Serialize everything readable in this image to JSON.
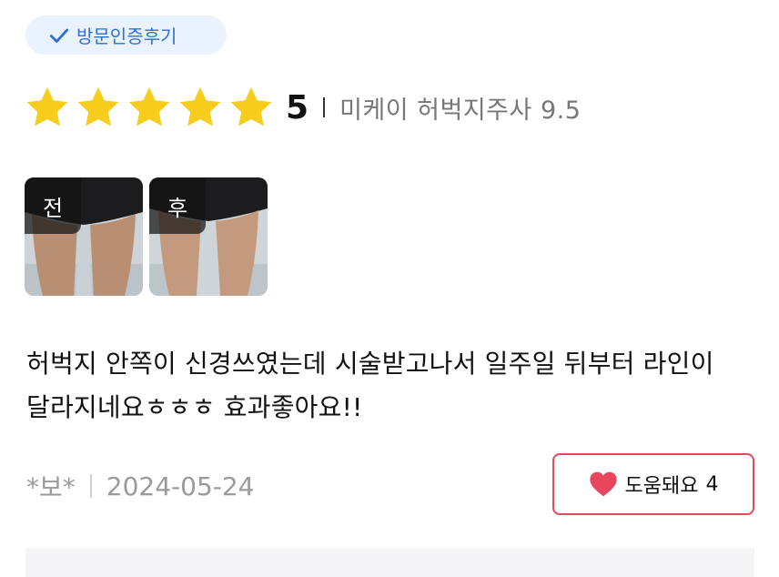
{
  "badge": {
    "label": "방문인증후기",
    "icon": "check-icon",
    "color": "#2f6fd6"
  },
  "rating": {
    "stars": 5,
    "score": "5",
    "product": "미케이 허벅지주사 9.5",
    "star_color": "#f7cc1b"
  },
  "photos": [
    {
      "tag": "전"
    },
    {
      "tag": "후"
    }
  ],
  "review": {
    "text": "허벅지 안쪽이 신경쓰였는데 시술받고나서 일주일 뒤부터 라인이 달라지네요ㅎㅎㅎ 효과좋아요!!"
  },
  "meta": {
    "author": "*보*",
    "date": "2024-05-24"
  },
  "helpful_button": {
    "label": "도움돼요",
    "count": "4",
    "icon": "heart-icon",
    "accent": "#e8465e"
  }
}
